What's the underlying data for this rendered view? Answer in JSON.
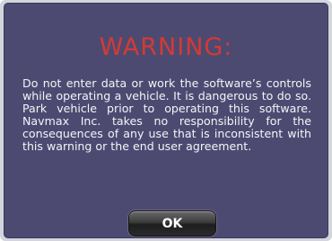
{
  "dialog": {
    "title": "WARNING:",
    "message": "Do not enter data or work the software’s controls while operating a vehicle. It is dangerous to do so. Park vehicle prior to operating this software. Navmax Inc. takes no responsibility for the consequences of any use that is inconsistent with this warning or the end user agreement.",
    "ok_label": "OK"
  },
  "colors": {
    "background": "#4d4a72",
    "title": "#d43a33",
    "text": "#f4f4f6",
    "frame": "#d4d5dc",
    "button": "#2a2a2a"
  }
}
